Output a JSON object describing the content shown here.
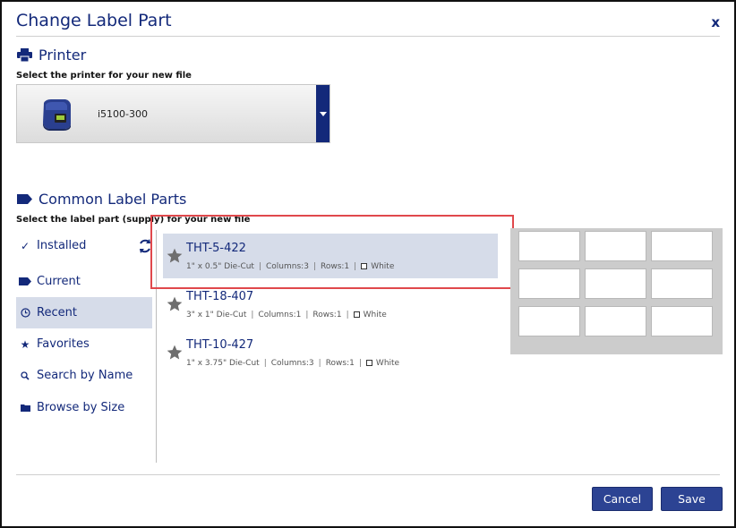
{
  "dialog": {
    "title": "Change Label Part",
    "close_label": "x"
  },
  "printer_section": {
    "heading": "Printer",
    "subtitle": "Select the printer for your new file",
    "selected_printer": "i5100-300"
  },
  "parts_section": {
    "heading": "Common Label Parts",
    "subtitle": "Select the label part (supply) for your new file"
  },
  "nav": [
    {
      "label": "Installed",
      "icon": "check-icon"
    },
    {
      "label": "Current",
      "icon": "label-icon"
    },
    {
      "label": "Recent",
      "icon": "clock-icon",
      "active": true
    },
    {
      "label": "Favorites",
      "icon": "star-icon"
    },
    {
      "label": "Search by Name",
      "icon": "search-icon"
    },
    {
      "label": "Browse by Size",
      "icon": "folder-icon"
    }
  ],
  "parts": [
    {
      "name": "THT-5-422",
      "size": "1\" x 0.5\" Die-Cut",
      "columns": "Columns:3",
      "rows": "Rows:1",
      "color": "White",
      "selected": true
    },
    {
      "name": "THT-18-407",
      "size": "3\" x 1\" Die-Cut",
      "columns": "Columns:1",
      "rows": "Rows:1",
      "color": "White"
    },
    {
      "name": "THT-10-427",
      "size": "1\" x 3.75\" Die-Cut",
      "columns": "Columns:3",
      "rows": "Rows:1",
      "color": "White"
    }
  ],
  "buttons": {
    "cancel": "Cancel",
    "save": "Save"
  },
  "colors": {
    "brand": "#13297a",
    "button": "#2c4393",
    "selection": "#d6dce9",
    "highlight_box": "#e0484c"
  }
}
